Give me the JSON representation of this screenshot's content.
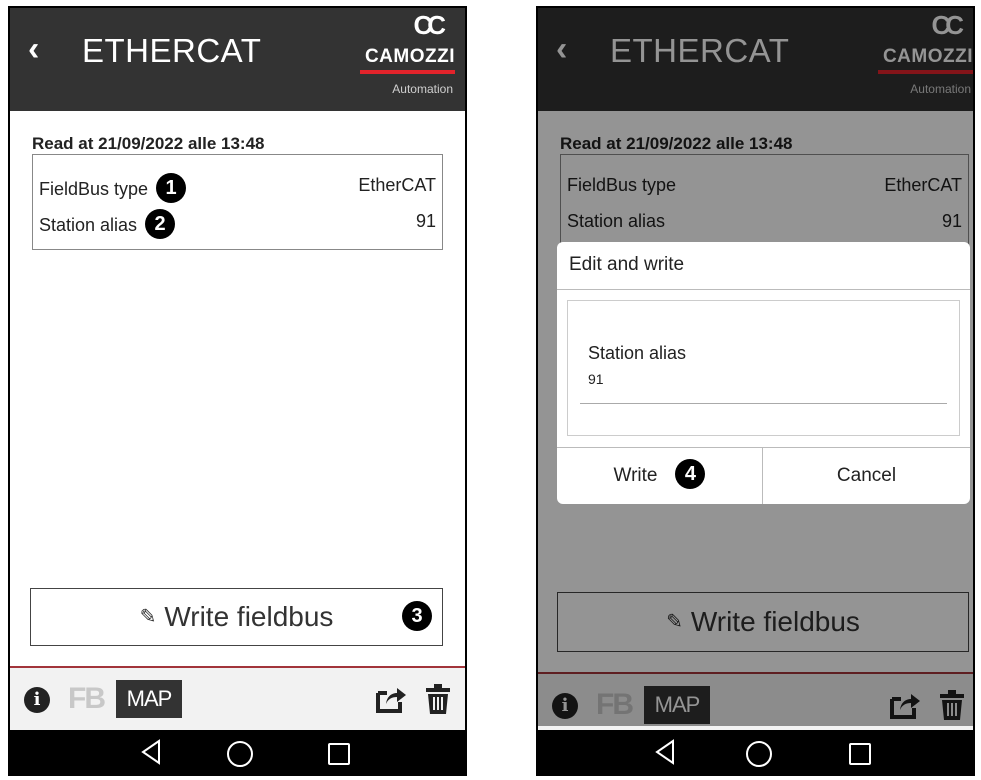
{
  "left_screen": {
    "header": {
      "title": "ETHERCAT",
      "logo_mark": "CC",
      "logo_name": "CAMOZZI",
      "logo_sub": "Automation"
    },
    "read_at": "Read at 21/09/2022 alle 13:48",
    "params": [
      {
        "label": "FieldBus type",
        "value": "EtherCAT",
        "badge": "1"
      },
      {
        "label": "Station alias",
        "value": "91",
        "badge": "2"
      }
    ],
    "write_button": {
      "label": "Write fieldbus",
      "badge": "3"
    },
    "toolbar": {
      "info": "i",
      "fb": "FB",
      "map": "MAP"
    }
  },
  "right_screen": {
    "header": {
      "title": "ETHERCAT",
      "logo_mark": "CC",
      "logo_name": "CAMOZZI",
      "logo_sub": "Automation"
    },
    "read_at": "Read at 21/09/2022 alle 13:48",
    "params": [
      {
        "label": "FieldBus type",
        "value": "EtherCAT"
      },
      {
        "label": "Station alias",
        "value": "91"
      }
    ],
    "write_button": {
      "label": "Write fieldbus"
    },
    "toolbar": {
      "info": "i",
      "fb": "FB",
      "map": "MAP"
    },
    "dialog": {
      "title": "Edit and write",
      "field_label": "Station alias",
      "field_value": "91",
      "write_label": "Write",
      "write_badge": "4",
      "cancel_label": "Cancel"
    }
  },
  "colors": {
    "header_bg": "#333333",
    "accent_red": "#e3232b",
    "footer_line": "#a2343a",
    "nav_bg": "#000000"
  },
  "icons": [
    "back-chevron-icon",
    "camozzi-logo-icon",
    "edit-icon",
    "info-icon",
    "fb-icon",
    "map-icon",
    "share-icon",
    "trash-icon",
    "nav-back-icon",
    "nav-home-icon",
    "nav-recent-icon"
  ]
}
